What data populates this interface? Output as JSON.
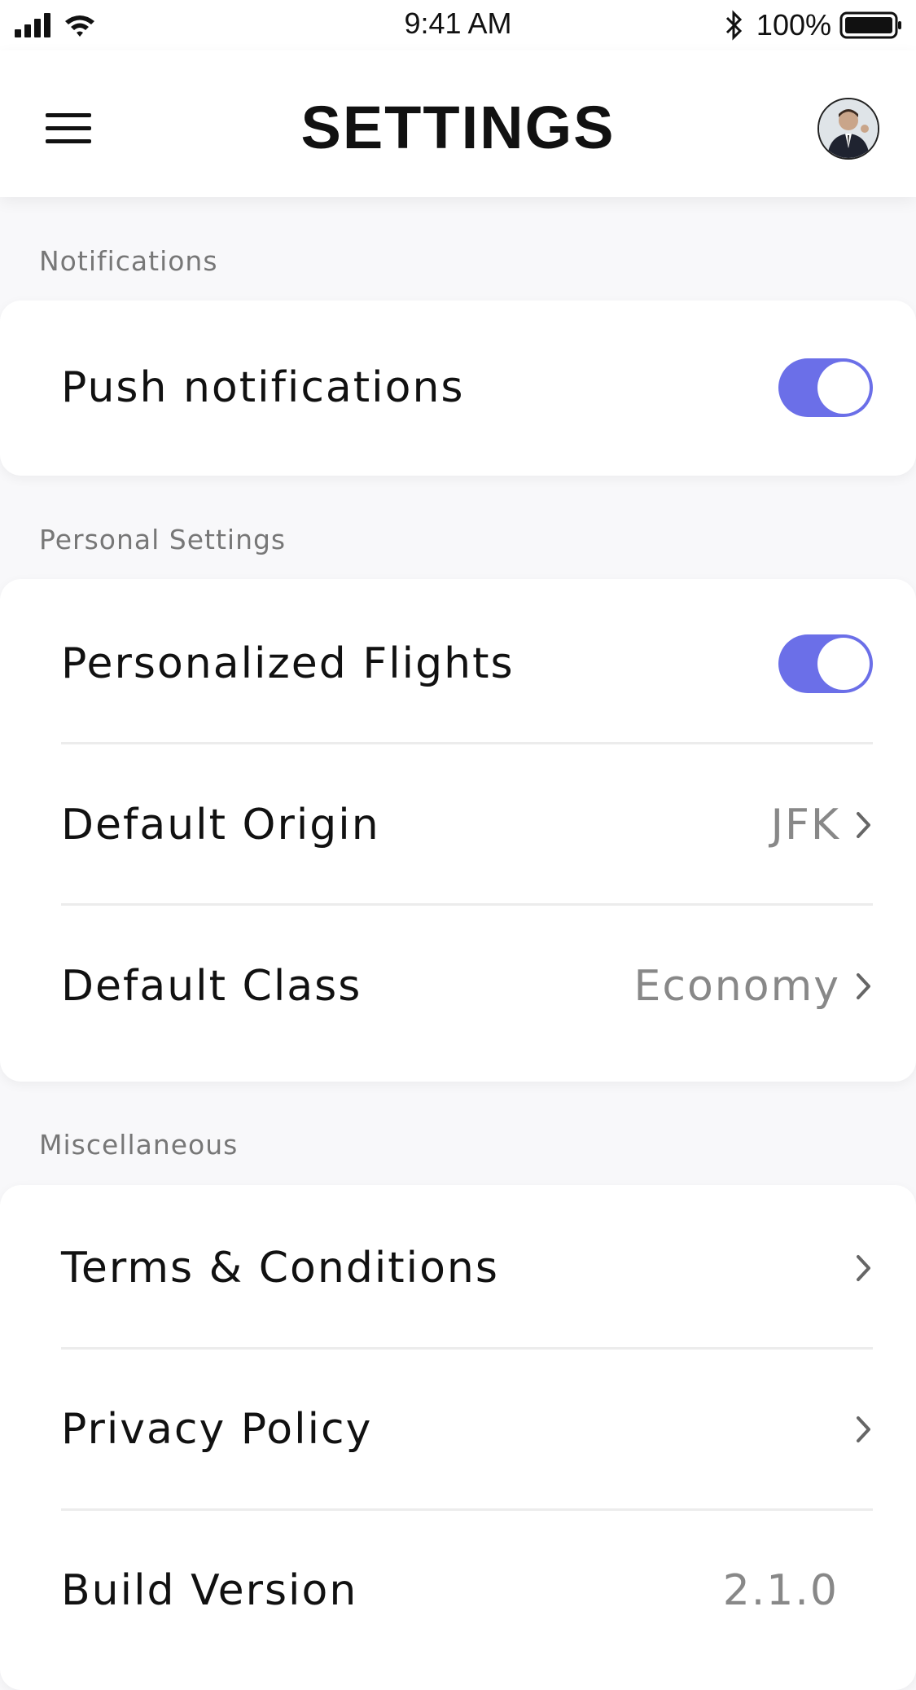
{
  "status_bar": {
    "time": "9:41 AM",
    "battery_percent": "100%",
    "icons": [
      "cellular-signal-icon",
      "wifi-icon",
      "bluetooth-icon",
      "battery-icon"
    ]
  },
  "header": {
    "title": "SETTINGS",
    "menu_icon": "hamburger-menu-icon",
    "avatar": "user-avatar"
  },
  "sections": {
    "notifications": {
      "label": "Notifications",
      "push_notifications": {
        "label": "Push notifications",
        "enabled": true
      }
    },
    "personal": {
      "label": "Personal Settings",
      "personalized_flights": {
        "label": "Personalized Flights",
        "enabled": true
      },
      "default_origin": {
        "label": "Default Origin",
        "value": "JFK"
      },
      "default_class": {
        "label": "Default Class",
        "value": "Economy"
      }
    },
    "misc": {
      "label": "Miscellaneous",
      "terms": {
        "label": "Terms & Conditions"
      },
      "privacy": {
        "label": "Privacy Policy"
      },
      "build_version": {
        "label": "Build Version",
        "value": "2.1.0"
      }
    }
  },
  "colors": {
    "toggle_on": "#6b6fe8",
    "background": "#f8f8fa",
    "card": "#ffffff",
    "secondary_text": "#888888"
  }
}
